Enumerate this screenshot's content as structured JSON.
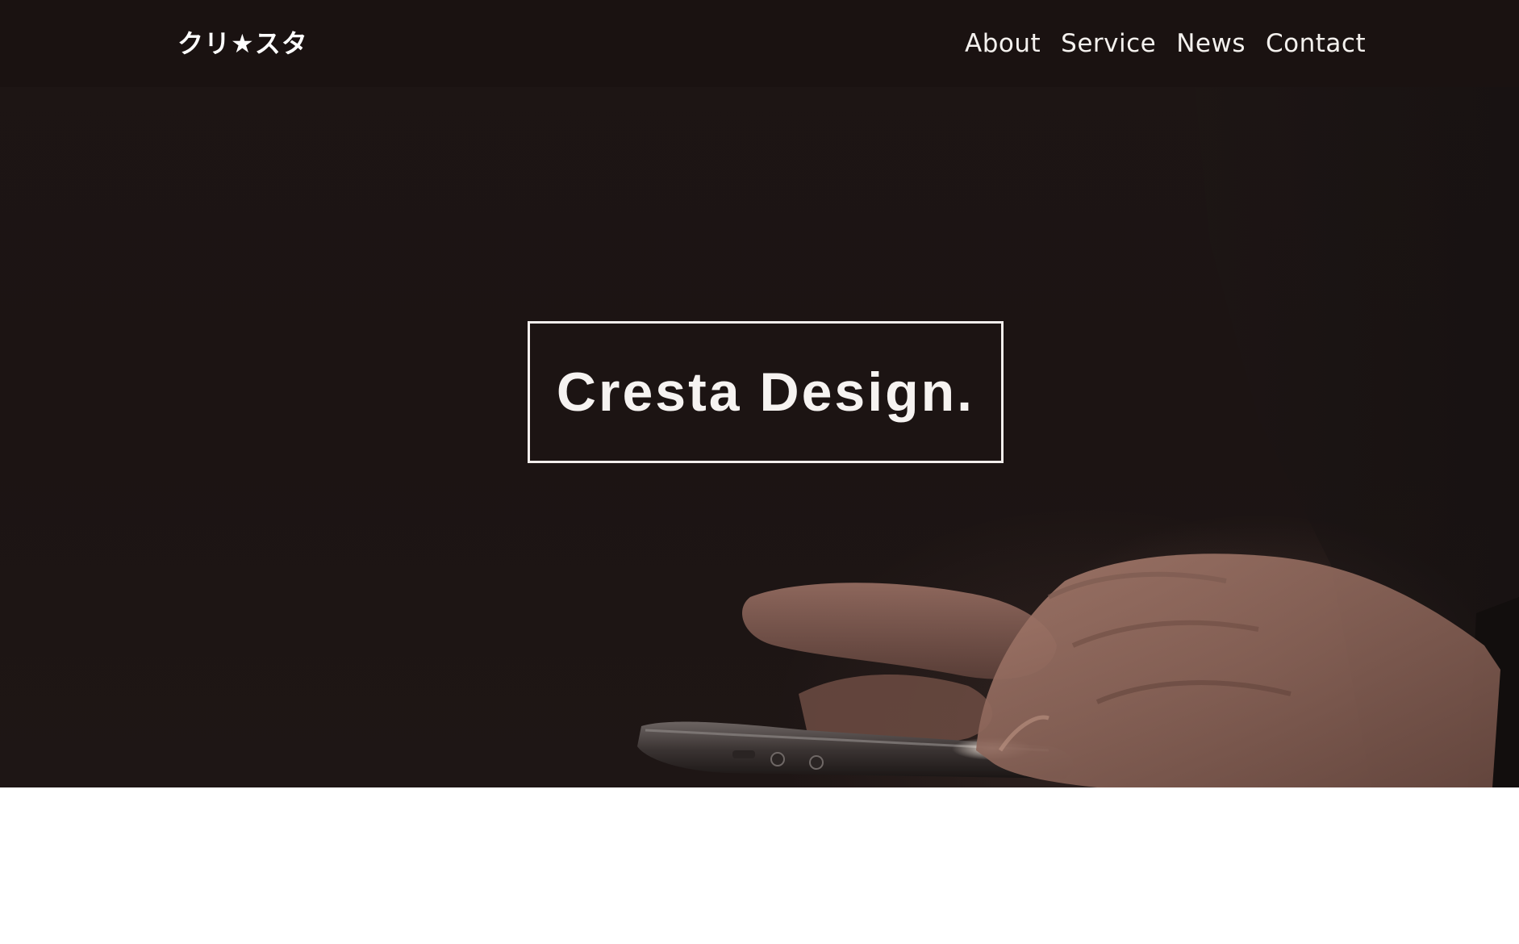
{
  "header": {
    "logo": "クリ★スタ",
    "nav": {
      "about": "About",
      "service": "Service",
      "news": "News",
      "contact": "Contact"
    }
  },
  "hero": {
    "title": "Cresta Design.",
    "background_image": "hands holding smartphone in dark room"
  },
  "colors": {
    "hero_background": "#1c1413",
    "header_background": "#1a1211",
    "text": "#ffffff",
    "page_background": "#ffffff"
  }
}
